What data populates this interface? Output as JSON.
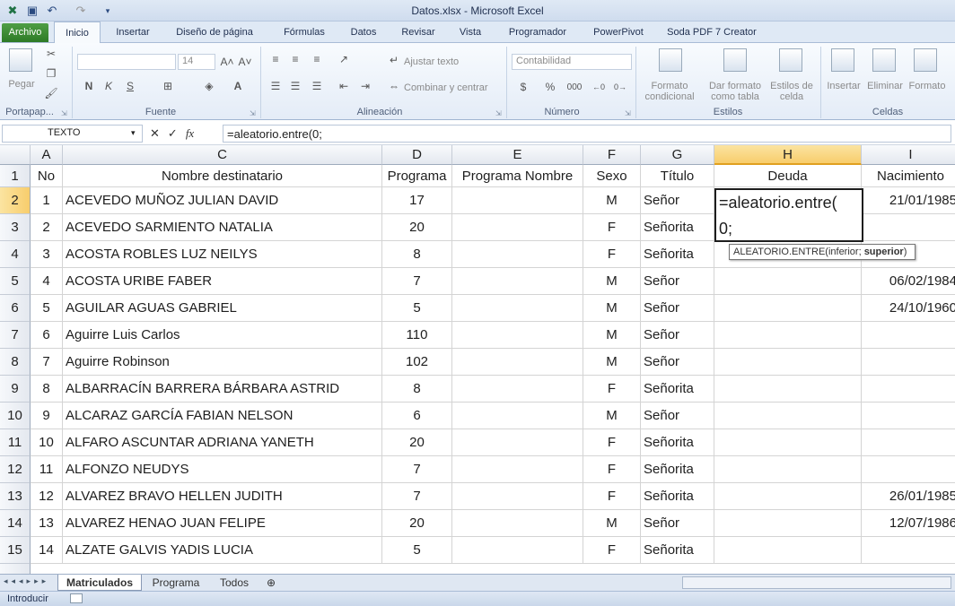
{
  "window": {
    "title": "Datos.xlsx  -  Microsoft Excel"
  },
  "ribbon_tabs": [
    {
      "label": "Archivo"
    },
    {
      "label": "Inicio"
    },
    {
      "label": "Insertar"
    },
    {
      "label": "Diseño de página"
    },
    {
      "label": "Fórmulas"
    },
    {
      "label": "Datos"
    },
    {
      "label": "Revisar"
    },
    {
      "label": "Vista"
    },
    {
      "label": "Programador"
    },
    {
      "label": "PowerPivot"
    },
    {
      "label": "Soda PDF 7 Creator"
    }
  ],
  "ribbon": {
    "paste": "Pegar",
    "font_size": "14",
    "bold": "N",
    "italic": "K",
    "underline": "S",
    "wrap_text": "Ajustar texto",
    "merge_center": "Combinar y centrar",
    "number_format": "Contabilidad",
    "currency": "$",
    "percent": "%",
    "thousands": "000",
    "cond_format": "Formato condicional",
    "format_table": "Dar formato como tabla",
    "cell_styles": "Estilos de celda",
    "insert": "Insertar",
    "delete": "Eliminar",
    "format": "Formato",
    "groups": {
      "clipboard": "Portapap...",
      "font": "Fuente",
      "alignment": "Alineación",
      "number": "Número",
      "styles": "Estilos",
      "cells": "Celdas"
    }
  },
  "formula_bar": {
    "name_box": "TEXTO",
    "fx": "fx",
    "formula": "=aleatorio.entre(0;"
  },
  "columns": [
    "A",
    "B",
    "C",
    "D",
    "E",
    "F",
    "G",
    "H",
    "I"
  ],
  "header_row": [
    "No",
    "Nombre destinatario",
    "Programa",
    "Programa Nombre",
    "Sexo",
    "Título",
    "Deuda",
    "Nacimiento"
  ],
  "rows": [
    {
      "no": "1",
      "name": "ACEVEDO MUÑOZ JULIAN DAVID",
      "prog": "17",
      "sex": "M",
      "title": "Señor",
      "birth": "21/01/1985"
    },
    {
      "no": "2",
      "name": "ACEVEDO SARMIENTO NATALIA",
      "prog": "20",
      "sex": "F",
      "title": "Señorita",
      "birth": ""
    },
    {
      "no": "3",
      "name": "ACOSTA ROBLES LUZ NEILYS",
      "prog": "8",
      "sex": "F",
      "title": "Señorita",
      "birth": ""
    },
    {
      "no": "4",
      "name": "ACOSTA URIBE FABER",
      "prog": "7",
      "sex": "M",
      "title": "Señor",
      "birth": "06/02/1984"
    },
    {
      "no": "5",
      "name": "AGUILAR AGUAS GABRIEL",
      "prog": "5",
      "sex": "M",
      "title": "Señor",
      "birth": "24/10/1960"
    },
    {
      "no": "6",
      "name": "Aguirre Luis Carlos",
      "prog": "110",
      "sex": "M",
      "title": "Señor",
      "birth": ""
    },
    {
      "no": "7",
      "name": "Aguirre Robinson",
      "prog": "102",
      "sex": "M",
      "title": "Señor",
      "birth": ""
    },
    {
      "no": "8",
      "name": "ALBARRACÍN BARRERA BÁRBARA ASTRID",
      "prog": "8",
      "sex": "F",
      "title": "Señorita",
      "birth": ""
    },
    {
      "no": "9",
      "name": "ALCARAZ GARCÍA FABIAN NELSON",
      "prog": "6",
      "sex": "M",
      "title": "Señor",
      "birth": ""
    },
    {
      "no": "10",
      "name": "ALFARO ASCUNTAR ADRIANA YANETH",
      "prog": "20",
      "sex": "F",
      "title": "Señorita",
      "birth": ""
    },
    {
      "no": "11",
      "name": "ALFONZO NEUDYS",
      "prog": "7",
      "sex": "F",
      "title": "Señorita",
      "birth": ""
    },
    {
      "no": "12",
      "name": "ALVAREZ BRAVO HELLEN JUDITH",
      "prog": "7",
      "sex": "F",
      "title": "Señorita",
      "birth": "26/01/1985"
    },
    {
      "no": "13",
      "name": "ALVAREZ HENAO JUAN FELIPE",
      "prog": "20",
      "sex": "M",
      "title": "Señor",
      "birth": "12/07/1986"
    },
    {
      "no": "14",
      "name": "ALZATE GALVIS YADIS LUCIA",
      "prog": "5",
      "sex": "F",
      "title": "Señorita",
      "birth": ""
    }
  ],
  "editing_cell": {
    "line1": "=aleatorio.entre(",
    "line2": "0;"
  },
  "tooltip": {
    "fn": "ALEATORIO.ENTRE(inferior; ",
    "arg": "superior",
    "close": ")"
  },
  "sheet_tabs": [
    {
      "label": "Matriculados"
    },
    {
      "label": "Programa"
    },
    {
      "label": "Todos"
    }
  ],
  "status": {
    "mode": "Introducir"
  }
}
